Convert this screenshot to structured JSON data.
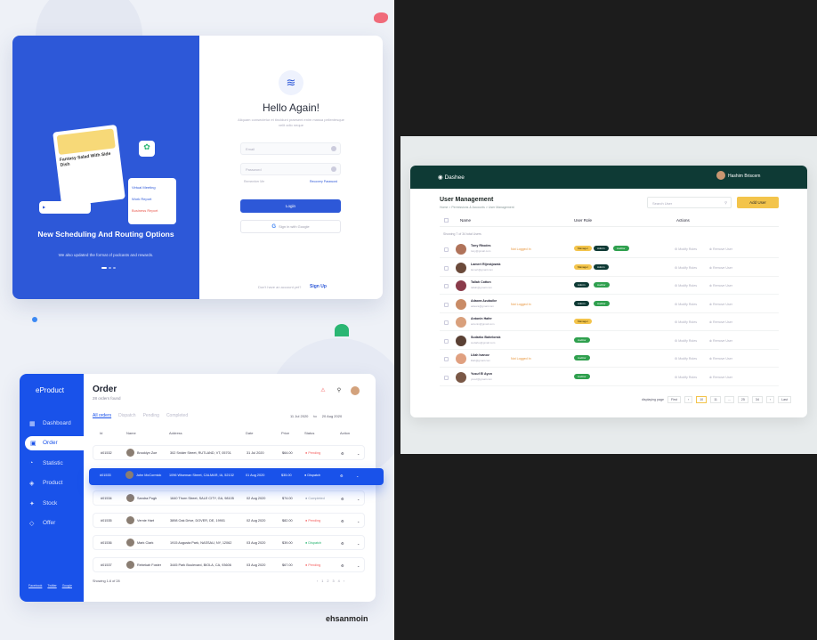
{
  "login": {
    "illus_card_title": "Fantasy Salad With Side Dish",
    "mini_card_items": [
      "Virtual Meeting",
      "Work Report",
      "Business Report"
    ],
    "headline": "New Scheduling And Routing Options",
    "subtext": "We also updated the format of podcasts and rewards.",
    "hello": "Hello Again!",
    "welcome": "Aliquam consectetur et tincidunt praesent enim massa pellentesque velit odio neque",
    "email_placeholder": "Email",
    "password_placeholder": "Password",
    "remember": "Remember Me",
    "recover": "Recovery Password",
    "login_btn": "Login",
    "google_btn": "Sign in with Google",
    "no_account": "Don't have an account yet?",
    "signup": "Sign Up"
  },
  "order": {
    "brand": "eProduct",
    "nav": [
      {
        "icon": "▦",
        "label": "Dashboard"
      },
      {
        "icon": "▣",
        "label": "Order"
      },
      {
        "icon": "◔",
        "label": "Statistic"
      },
      {
        "icon": "◈",
        "label": "Product"
      },
      {
        "icon": "✦",
        "label": "Stock"
      },
      {
        "icon": "◇",
        "label": "Offer"
      }
    ],
    "footer_links": [
      "Facebook",
      "Twitter",
      "Google"
    ],
    "title": "Order",
    "count": "28 orders found",
    "tabs": [
      "All orders",
      "Dispatch",
      "Pending",
      "Completed"
    ],
    "date_from": "11 Jul 2020",
    "date_to_label": "to",
    "date_to": "20 Aug 2020",
    "columns": [
      "Id",
      "Name",
      "Address",
      "Date",
      "Price",
      "Status",
      "Action"
    ],
    "rows": [
      {
        "id": "#01532",
        "name": "Brooklyn Zoe",
        "address": "302 Snider Street, RUTLAND, VT, 05701",
        "date": "31 Jul 2020",
        "price": "$64.00",
        "status": "Pending",
        "st": "p"
      },
      {
        "id": "#01533",
        "name": "John McCormick",
        "address": "1096 Wiseman Street, CALMAR, IA, 52132",
        "date": "01 Aug 2020",
        "price": "$35.00",
        "status": "Dispatch",
        "st": "d"
      },
      {
        "id": "#01534",
        "name": "Sandra Pugh",
        "address": "1640 Thorn Street, SALE CITY, GA, 98105",
        "date": "02 Aug 2020",
        "price": "$74.00",
        "status": "Completed",
        "st": "c"
      },
      {
        "id": "#01535",
        "name": "Vernie Hart",
        "address": "3898 Oak Drive, DOVER, DE, 19901",
        "date": "02 Aug 2020",
        "price": "$82.00",
        "status": "Pending",
        "st": "p"
      },
      {
        "id": "#01536",
        "name": "Mark Clark",
        "address": "1915 Augusta Park, NASSAU, NY, 12062",
        "date": "03 Aug 2020",
        "price": "$39.00",
        "status": "Dispatch",
        "st": "d"
      },
      {
        "id": "#01537",
        "name": "Rebekah Foster",
        "address": "3445 Park Boulevard, BIOLA, CA, 93606",
        "date": "03 Aug 2020",
        "price": "$67.00",
        "status": "Pending",
        "st": "p"
      }
    ],
    "showing": "Showing 1-6 of 28",
    "pages": [
      "‹",
      "1",
      "2",
      "3",
      "4",
      "›"
    ]
  },
  "signature": "ehsanmoin",
  "dashee": {
    "brand": "Dashee",
    "user": "Hashim Briscem",
    "title": "User Management",
    "breadcrumb": "Home > Permissions & Accounts > User Management",
    "search_placeholder": "Search User",
    "add_btn": "Add User",
    "cols": [
      "Name",
      "User Role",
      "Actions"
    ],
    "showing": "Showing 7 of 34 total Users",
    "users": [
      {
        "name": "Tony Rhodes",
        "email": "tony@gmail.com",
        "log": "Not Logged In",
        "roles": [
          "Manager",
          "Admin",
          "Auditor"
        ]
      },
      {
        "name": "Lamert Rijeskjowsk",
        "email": "lamert@gmail.com",
        "log": "",
        "roles": [
          "Manager",
          "Admin"
        ]
      },
      {
        "name": "Tallah Cotton",
        "email": "tallah@gmail.com",
        "log": "",
        "roles": [
          "Admin",
          "Auditor"
        ]
      },
      {
        "name": "Adaora Azubuike",
        "email": "adaora@gmail.com",
        "log": "Not Logged In",
        "roles": [
          "Admin",
          "Auditor"
        ]
      },
      {
        "name": "Antonin Hafer",
        "email": "antonin@gmail.com",
        "log": "",
        "roles": [
          "Manager"
        ]
      },
      {
        "name": "Sudarko Bahelonsk",
        "email": "sudarko@gmail.com",
        "log": "",
        "roles": [
          "Auditor"
        ]
      },
      {
        "name": "Lilah Ivanov",
        "email": "lilah@gmail.com",
        "log": "Not Logged In",
        "roles": [
          "Auditor"
        ]
      },
      {
        "name": "Yusuf El Ayon",
        "email": "yusuf@gmail.com",
        "log": "",
        "roles": [
          "Auditor"
        ]
      }
    ],
    "modify": "Modify Roles",
    "remove": "Remove User",
    "displaying": "displaying page",
    "pages": [
      "First",
      "‹",
      "10",
      "11",
      "...",
      "25",
      "34",
      "›",
      "Last"
    ]
  }
}
